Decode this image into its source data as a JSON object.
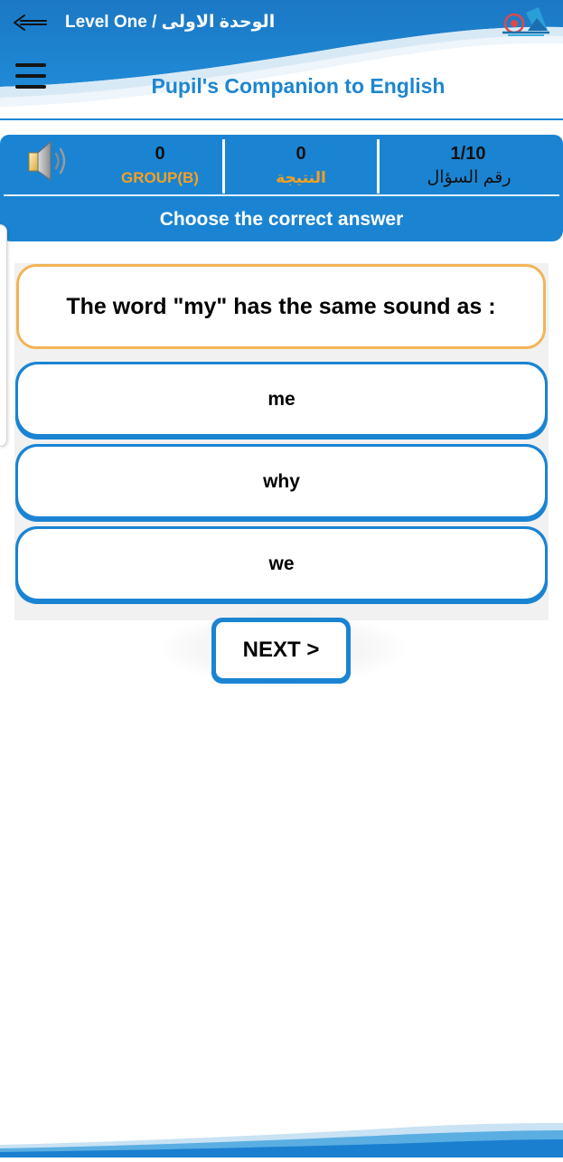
{
  "header": {
    "title": "Level One / الوحدة الاولى",
    "app_title": "Pupil's Companion to English",
    "back_icon": "back-arrow-icon",
    "menu_icon": "hamburger-menu-icon",
    "logo_icon": "app-logo-icon"
  },
  "stats": {
    "sound_icon": "speaker-icon",
    "group": {
      "value": "0",
      "label": "GROUP(B)"
    },
    "score": {
      "value": "0",
      "label": "النتيجة"
    },
    "question_number": {
      "value": "1/10",
      "label": "رقم السؤال"
    },
    "instruction": "Choose the correct answer"
  },
  "quiz": {
    "question": "The word \"my\" has the same sound as :",
    "options": [
      "me",
      "why",
      "we"
    ],
    "next_label": "NEXT >"
  },
  "colors": {
    "primary_blue": "#1a84d3",
    "accent_orange": "#f5a021",
    "question_border": "#f2b457",
    "title_blue": "#1d86d0"
  }
}
